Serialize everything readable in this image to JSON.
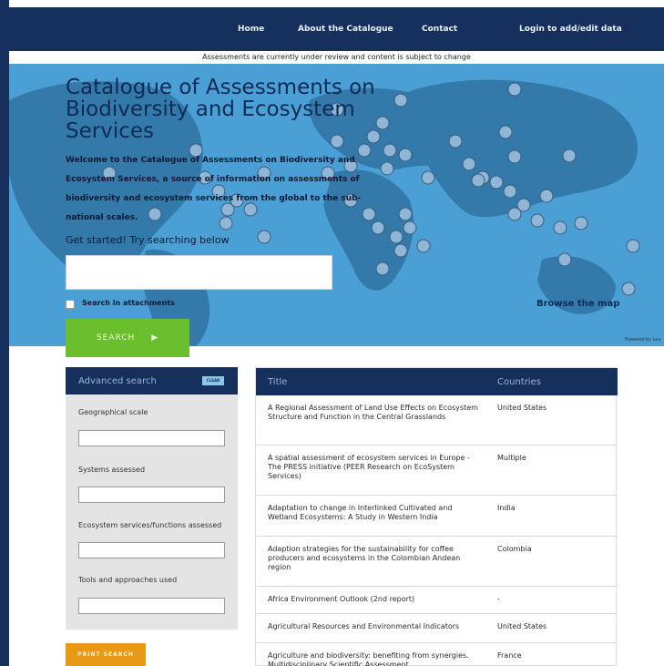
{
  "nav": {
    "items": [
      {
        "label": "Home"
      },
      {
        "label": "About the Catalogue"
      },
      {
        "label": "Contact"
      },
      {
        "label": "Login to add/edit data"
      }
    ]
  },
  "notice": "Assessments are currently under review and content is subject to change",
  "hero": {
    "title": "Catalogue of Assessments on Biodiversity and Ecosystem Services",
    "intro": "Welcome to the Catalogue of Assessments on Biodiversity and Ecosystem Services, a source of information on assessments of biodiversity and ecosystem services from the global to the sub-national scales.",
    "cta": "Get started! Try searching below",
    "search_value": "",
    "attachments_label": "Search in attachments",
    "attachments_checked": false,
    "browse_map": "Browse the map",
    "powered_by": "Powered by Lea"
  },
  "search_button": {
    "label": "SEARCH",
    "icon": "play-triangle-icon"
  },
  "advanced": {
    "title": "Advanced search",
    "clear_label": "CLEAR",
    "fields": [
      {
        "label": "Geographical scale",
        "value": ""
      },
      {
        "label": "Systems assessed",
        "value": ""
      },
      {
        "label": "Ecosystem services/functions assessed",
        "value": ""
      },
      {
        "label": "Tools and approaches used",
        "value": ""
      }
    ]
  },
  "print_button": "PRINT SEARCH",
  "results": {
    "columns": {
      "title": "Title",
      "countries": "Countries"
    },
    "rows": [
      {
        "title": "A Regional Assessment of Land Use Effects on Ecosystem Structure and Function in the Central Grasslands",
        "countries": "United States"
      },
      {
        "title": "A spatial assessment of ecosystem services in Europe - The PRESS initiative (PEER Research on EcoSystem Services)",
        "countries": "Multiple"
      },
      {
        "title": "Adaptation to change in Interlinked Cultivated and Wetland Ecosystems: A Study in Western India",
        "countries": "India"
      },
      {
        "title": "Adaption strategies for the sustainability for coffee producers and ecosystems in the Colombian Andean region",
        "countries": "Colombia"
      },
      {
        "title": "Africa Environment Outlook (2nd report)",
        "countries": "-"
      },
      {
        "title": "Agricultural Resources and Environmental Indicators",
        "countries": "United States"
      },
      {
        "title": "Agriculture and biodiversity: benefiting from synergies. Multidisciplinary Scientific Assessment",
        "countries": "France"
      }
    ]
  },
  "colors": {
    "navy": "#16305e",
    "map_ocean": "#4aa0d4",
    "land": "#2d6e9e",
    "search_green": "#6cbf2c",
    "print_orange": "#e89a17"
  }
}
